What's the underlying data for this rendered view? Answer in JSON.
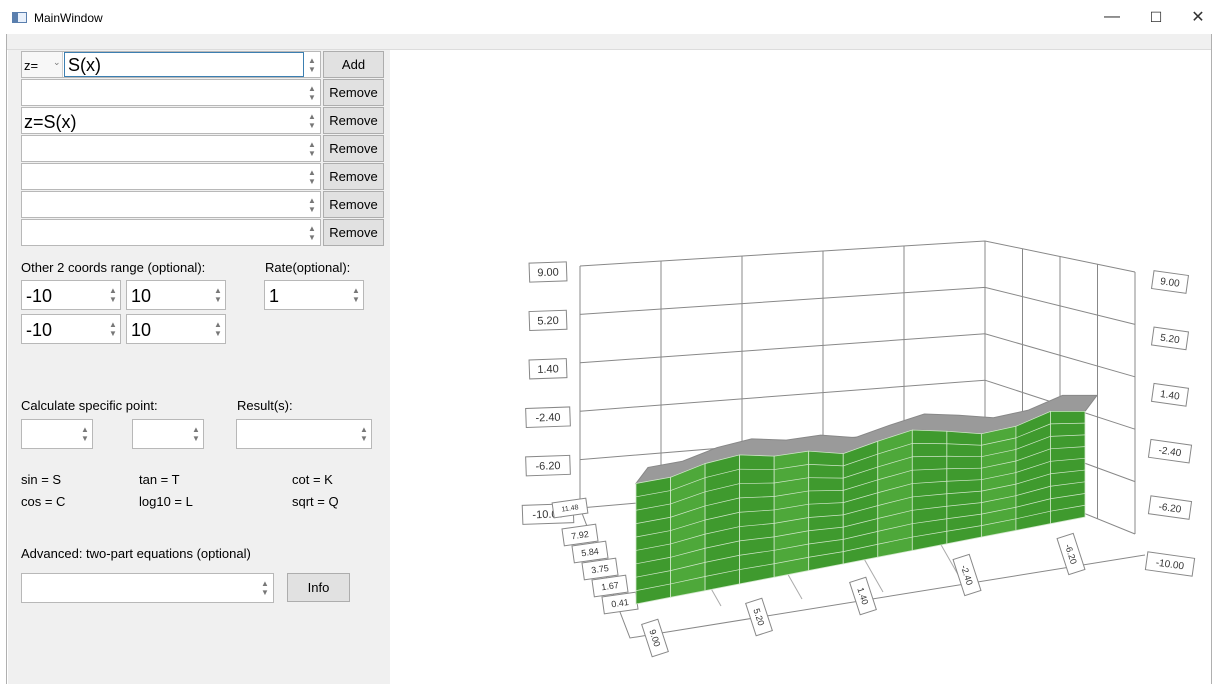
{
  "window": {
    "title": "MainWindow",
    "minimize_glyph": "—",
    "maximize_glyph": "☐",
    "close_glyph": "✕"
  },
  "equations": {
    "prefix_select": "z=",
    "input_value": "S(x)",
    "add_label": "Add",
    "remove_label": "Remove",
    "rows": [
      "",
      "z=S(x)",
      "",
      "",
      "",
      ""
    ]
  },
  "ranges": {
    "label": "Other 2 coords range (optional):",
    "rate_label": "Rate(optional):",
    "a_min": "-10",
    "a_max": "10",
    "b_min": "-10",
    "b_max": "10",
    "rate": "1"
  },
  "calc": {
    "label": "Calculate specific point:",
    "result_label": "Result(s):",
    "input1": "",
    "input2": "",
    "result": ""
  },
  "legend": {
    "sin": "sin = S",
    "tan": "tan = T",
    "cot": "cot = K",
    "cos": "cos = C",
    "log10": "log10 = L",
    "sqrt": "sqrt = Q"
  },
  "advanced": {
    "label": "Advanced: two-part equations (optional)",
    "input": "",
    "info_label": "Info"
  },
  "chart_data": {
    "type": "surface",
    "surface_color": "#3f9a2e",
    "back_color": "#9a9a9a",
    "left_axis_ticks": [
      "9.00",
      "5.20",
      "1.40",
      "-2.40",
      "-6.20",
      "-10.00"
    ],
    "right_axis_ticks": [
      "9.00",
      "5.20",
      "1.40",
      "-2.40",
      "-6.20",
      "-10.00"
    ],
    "front_axis_ticks": [
      "11.48",
      "7.92",
      "5.84",
      "3.75",
      "1.67",
      "0.41"
    ],
    "bottom_axis_ticks": [
      "9.00",
      "5.20",
      "1.40",
      "-2.40",
      "-6.20"
    ],
    "front_axis_ticks_small": [
      "-10.00"
    ],
    "surface_top_z": [
      -7.7,
      -7.2,
      -6.1,
      -5.4,
      -5.5,
      -5.1,
      -5.3,
      -4.3,
      -3.4,
      -3.5,
      -3.7,
      -3.1,
      -1.9,
      -1.9
    ],
    "surface_bottom_z": [
      -10.0,
      -10.0,
      -10.0,
      -10.0,
      -10.0,
      -10.0,
      -10.0,
      -10.0,
      -10.0,
      -10.0,
      -10.0,
      -10.0,
      -10.0,
      -10.0
    ]
  }
}
